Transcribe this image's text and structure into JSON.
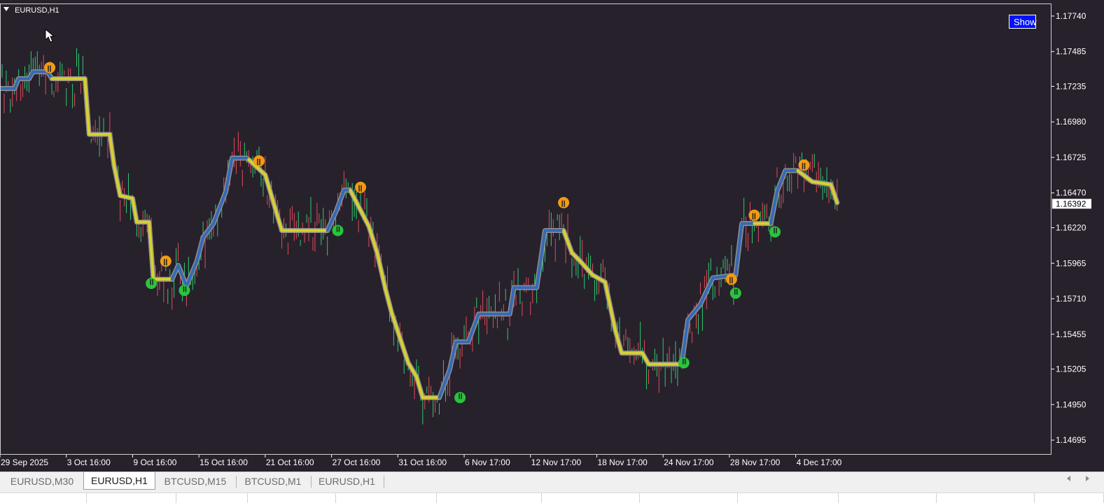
{
  "chart": {
    "symbol_label": "EURUSD,H1",
    "show_button_label": "Show",
    "current_price_label": "1.16392",
    "background_color": "#27212c",
    "border_color": "#cfcfcf",
    "axis_text_color": "#ffffff",
    "bull_candle_color": "#2fc96f",
    "bear_candle_color": "#e14b58",
    "uptrend_line_color": "#3469b7",
    "downtrend_line_color": "#d9d02e",
    "trend_line_outline_color": "#8f8f8f",
    "buy_marker_color": "#29c43c",
    "sell_marker_color": "#f39b12",
    "show_button_color": "#0012ff"
  },
  "chart_data": {
    "type": "candlestick",
    "symbol": "EURUSD",
    "timeframe": "H1",
    "price_ticks": [
      "1.17740",
      "1.17485",
      "1.17235",
      "1.16980",
      "1.16725",
      "1.16470",
      "1.16220",
      "1.15965",
      "1.15710",
      "1.15455",
      "1.15205",
      "1.14950",
      "1.14695"
    ],
    "time_ticks": [
      "29 Sep 2025",
      "3 Oct 16:00",
      "9 Oct 16:00",
      "15 Oct 16:00",
      "21 Oct 16:00",
      "27 Oct 16:00",
      "31 Oct 16:00",
      "6 Nov 17:00",
      "12 Nov 17:00",
      "18 Nov 17:00",
      "24 Nov 17:00",
      "28 Nov 17:00",
      "4 Dec 17:00"
    ],
    "current_price": 1.16392,
    "ylim": [
      1.1462,
      1.178
    ],
    "trend_line": [
      {
        "bar": 0,
        "price": 1.1722,
        "direction": "up"
      },
      {
        "bar": 7,
        "price": 1.1722,
        "direction": "up"
      },
      {
        "bar": 9,
        "price": 1.1729,
        "direction": "up"
      },
      {
        "bar": 14,
        "price": 1.1729,
        "direction": "up"
      },
      {
        "bar": 16,
        "price": 1.1734,
        "direction": "up"
      },
      {
        "bar": 23,
        "price": 1.1734,
        "direction": "up"
      },
      {
        "bar": 25,
        "price": 1.1729,
        "direction": "down"
      },
      {
        "bar": 41,
        "price": 1.1729,
        "direction": "down"
      },
      {
        "bar": 43,
        "price": 1.1689,
        "direction": "down"
      },
      {
        "bar": 53,
        "price": 1.1689,
        "direction": "down"
      },
      {
        "bar": 55,
        "price": 1.1667,
        "direction": "down"
      },
      {
        "bar": 58,
        "price": 1.1645,
        "direction": "down"
      },
      {
        "bar": 64,
        "price": 1.1643,
        "direction": "down"
      },
      {
        "bar": 66,
        "price": 1.1626,
        "direction": "down"
      },
      {
        "bar": 72,
        "price": 1.1626,
        "direction": "down"
      },
      {
        "bar": 74,
        "price": 1.1585,
        "direction": "down"
      },
      {
        "bar": 83,
        "price": 1.1585,
        "direction": "up"
      },
      {
        "bar": 86,
        "price": 1.1595,
        "direction": "up"
      },
      {
        "bar": 90,
        "price": 1.158,
        "direction": "up"
      },
      {
        "bar": 95,
        "price": 1.1598,
        "direction": "up"
      },
      {
        "bar": 98,
        "price": 1.1615,
        "direction": "up"
      },
      {
        "bar": 103,
        "price": 1.1625,
        "direction": "up"
      },
      {
        "bar": 109,
        "price": 1.1648,
        "direction": "up"
      },
      {
        "bar": 112,
        "price": 1.1672,
        "direction": "up"
      },
      {
        "bar": 119,
        "price": 1.1672,
        "direction": "up"
      },
      {
        "bar": 120,
        "price": 1.1671,
        "direction": "down"
      },
      {
        "bar": 128,
        "price": 1.166,
        "direction": "down"
      },
      {
        "bar": 134,
        "price": 1.163,
        "direction": "down"
      },
      {
        "bar": 136,
        "price": 1.162,
        "direction": "down"
      },
      {
        "bar": 158,
        "price": 1.162,
        "direction": "up"
      },
      {
        "bar": 162,
        "price": 1.1633,
        "direction": "up"
      },
      {
        "bar": 166,
        "price": 1.1649,
        "direction": "up"
      },
      {
        "bar": 169,
        "price": 1.1649,
        "direction": "down"
      },
      {
        "bar": 178,
        "price": 1.1623,
        "direction": "down"
      },
      {
        "bar": 182,
        "price": 1.1604,
        "direction": "down"
      },
      {
        "bar": 186,
        "price": 1.1578,
        "direction": "down"
      },
      {
        "bar": 189,
        "price": 1.1561,
        "direction": "down"
      },
      {
        "bar": 193,
        "price": 1.1543,
        "direction": "down"
      },
      {
        "bar": 197,
        "price": 1.1525,
        "direction": "down"
      },
      {
        "bar": 201,
        "price": 1.1515,
        "direction": "down"
      },
      {
        "bar": 204,
        "price": 1.15,
        "direction": "down"
      },
      {
        "bar": 212,
        "price": 1.15,
        "direction": "up"
      },
      {
        "bar": 217,
        "price": 1.152,
        "direction": "up"
      },
      {
        "bar": 220,
        "price": 1.154,
        "direction": "up"
      },
      {
        "bar": 226,
        "price": 1.154,
        "direction": "up"
      },
      {
        "bar": 231,
        "price": 1.156,
        "direction": "up"
      },
      {
        "bar": 246,
        "price": 1.156,
        "direction": "up"
      },
      {
        "bar": 248,
        "price": 1.1579,
        "direction": "up"
      },
      {
        "bar": 259,
        "price": 1.1579,
        "direction": "up"
      },
      {
        "bar": 263,
        "price": 1.162,
        "direction": "up"
      },
      {
        "bar": 272,
        "price": 1.162,
        "direction": "down"
      },
      {
        "bar": 276,
        "price": 1.1604,
        "direction": "down"
      },
      {
        "bar": 280,
        "price": 1.1598,
        "direction": "down"
      },
      {
        "bar": 286,
        "price": 1.1588,
        "direction": "down"
      },
      {
        "bar": 292,
        "price": 1.1583,
        "direction": "down"
      },
      {
        "bar": 297,
        "price": 1.1548,
        "direction": "down"
      },
      {
        "bar": 300,
        "price": 1.1532,
        "direction": "down"
      },
      {
        "bar": 310,
        "price": 1.1532,
        "direction": "down"
      },
      {
        "bar": 313,
        "price": 1.1524,
        "direction": "down"
      },
      {
        "bar": 329,
        "price": 1.1524,
        "direction": "up"
      },
      {
        "bar": 332,
        "price": 1.1556,
        "direction": "up"
      },
      {
        "bar": 338,
        "price": 1.1567,
        "direction": "up"
      },
      {
        "bar": 344,
        "price": 1.1586,
        "direction": "up"
      },
      {
        "bar": 355,
        "price": 1.1588,
        "direction": "up"
      },
      {
        "bar": 358,
        "price": 1.1625,
        "direction": "up"
      },
      {
        "bar": 364,
        "price": 1.1625,
        "direction": "down"
      },
      {
        "bar": 372,
        "price": 1.1625,
        "direction": "up"
      },
      {
        "bar": 375,
        "price": 1.1648,
        "direction": "up"
      },
      {
        "bar": 379,
        "price": 1.1663,
        "direction": "up"
      },
      {
        "bar": 385,
        "price": 1.1663,
        "direction": "down"
      },
      {
        "bar": 392,
        "price": 1.1655,
        "direction": "down"
      },
      {
        "bar": 401,
        "price": 1.1653,
        "direction": "down"
      },
      {
        "bar": 404,
        "price": 1.164,
        "direction": "down"
      }
    ],
    "signals": [
      {
        "bar": 24,
        "price": 1.1737,
        "type": "sell"
      },
      {
        "bar": 73,
        "price": 1.1582,
        "type": "buy"
      },
      {
        "bar": 80,
        "price": 1.1598,
        "type": "sell"
      },
      {
        "bar": 89,
        "price": 1.1577,
        "type": "buy"
      },
      {
        "bar": 125,
        "price": 1.167,
        "type": "sell"
      },
      {
        "bar": 163,
        "price": 1.162,
        "type": "buy"
      },
      {
        "bar": 174,
        "price": 1.1651,
        "type": "sell"
      },
      {
        "bar": 222,
        "price": 1.15,
        "type": "buy"
      },
      {
        "bar": 272,
        "price": 1.164,
        "type": "sell"
      },
      {
        "bar": 330,
        "price": 1.1525,
        "type": "buy"
      },
      {
        "bar": 353,
        "price": 1.1585,
        "type": "sell"
      },
      {
        "bar": 355,
        "price": 1.1575,
        "type": "buy"
      },
      {
        "bar": 364,
        "price": 1.1631,
        "type": "sell"
      },
      {
        "bar": 374,
        "price": 1.1619,
        "type": "buy"
      },
      {
        "bar": 388,
        "price": 1.1667,
        "type": "sell"
      }
    ]
  },
  "tabs": [
    {
      "label": "EURUSD,M30",
      "active": false
    },
    {
      "label": "EURUSD,H1",
      "active": true
    },
    {
      "label": "BTCUSD,M15",
      "active": false
    },
    {
      "label": "BTCUSD,M1",
      "active": false
    },
    {
      "label": "EURUSD,H1",
      "active": false
    }
  ],
  "bottom_headers": [
    "",
    "",
    "",
    "",
    "",
    "",
    "",
    "",
    "",
    "",
    "",
    "",
    ""
  ]
}
